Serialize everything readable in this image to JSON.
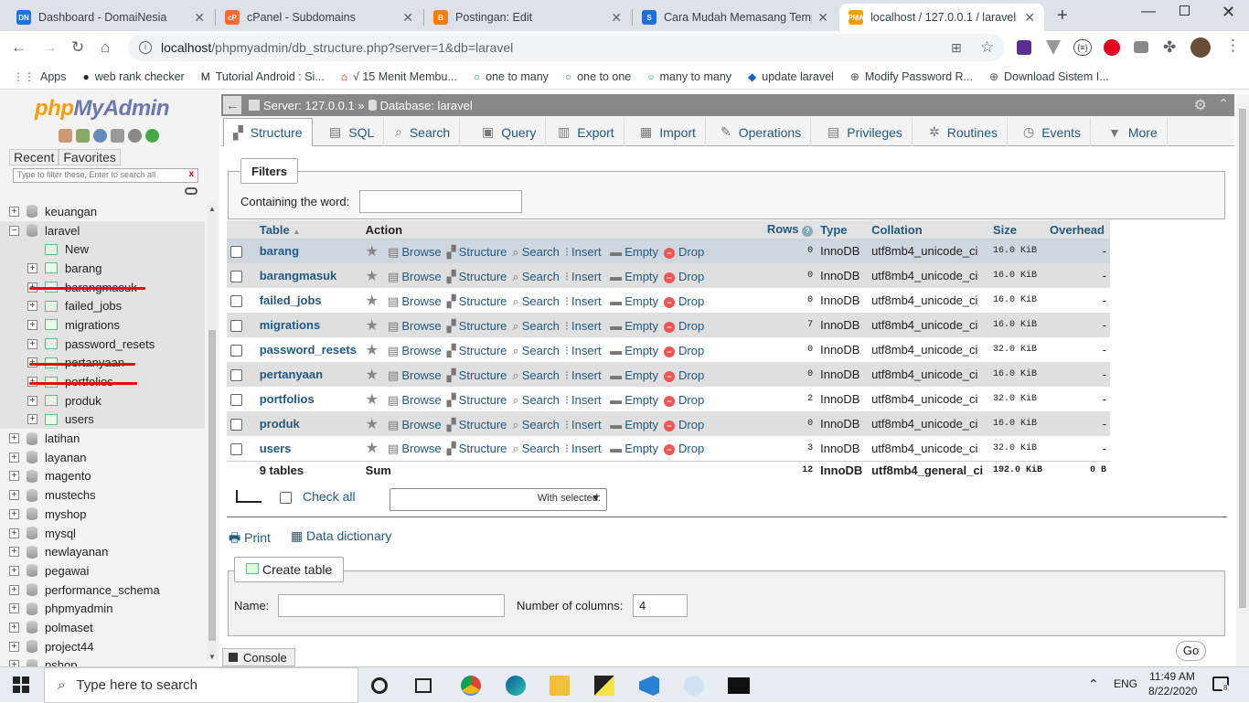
{
  "browser": {
    "tabs": [
      {
        "title": "Dashboard - DomaiNesia",
        "fav_color": "#1a73e8",
        "fav_text": "DN"
      },
      {
        "title": "cPanel - Subdomains",
        "fav_color": "#ff6c2c",
        "fav_text": "cP"
      },
      {
        "title": "Postingan: Edit",
        "fav_color": "#f57c00",
        "fav_text": "B"
      },
      {
        "title": "Cara Mudah Memasang Templ",
        "fav_color": "#1e6fd9",
        "fav_text": "S"
      },
      {
        "title": "localhost / 127.0.0.1 / laravel | ",
        "fav_color": "#f89c0e",
        "fav_text": "PMA"
      }
    ],
    "url_host": "localhost",
    "url_path": "/phpmyadmin/db_structure.php?server=1&db=laravel",
    "bookmarks": [
      {
        "icon": "grid-icon",
        "label": "Apps"
      },
      {
        "icon": "web-rank-icon",
        "label": "web rank checker"
      },
      {
        "icon": "m-icon",
        "label": "Tutorial Android : Si..."
      },
      {
        "icon": "home-icon",
        "label": "√ 15 Menit Membu..."
      },
      {
        "icon": "ring-icon",
        "label": "one to many"
      },
      {
        "icon": "ring-icon",
        "label": "one to one"
      },
      {
        "icon": "ring-icon",
        "label": "many to many"
      },
      {
        "icon": "diamond-icon",
        "label": "update laravel"
      },
      {
        "icon": "globe-icon",
        "label": "Modify Password R..."
      },
      {
        "icon": "globe-icon",
        "label": "Download Sistem I..."
      }
    ]
  },
  "nav": {
    "logo_php": "php",
    "logo_my": "MyAdmin",
    "recent": "Recent",
    "favorites": "Favorites",
    "filter_placeholder": "Type to filter these, Enter to search all",
    "filter_clear": "x",
    "databases": [
      {
        "name": "keuangan",
        "expanded": false
      },
      {
        "name": "laravel",
        "expanded": true,
        "children": [
          "New",
          "barang",
          "barangmasuk",
          "failed_jobs",
          "migrations",
          "password_resets",
          "pertanyaan",
          "portfolios",
          "produk",
          "users"
        ]
      },
      {
        "name": "latihan",
        "expanded": false
      },
      {
        "name": "layanan",
        "expanded": false
      },
      {
        "name": "magento",
        "expanded": false
      },
      {
        "name": "mustechs",
        "expanded": false
      },
      {
        "name": "myshop",
        "expanded": false
      },
      {
        "name": "mysql",
        "expanded": false
      },
      {
        "name": "newlayanan",
        "expanded": false
      },
      {
        "name": "pegawai",
        "expanded": false
      },
      {
        "name": "performance_schema",
        "expanded": false
      },
      {
        "name": "phpmyadmin",
        "expanded": false
      },
      {
        "name": "polmaset",
        "expanded": false
      },
      {
        "name": "project44",
        "expanded": false
      },
      {
        "name": "pshop",
        "expanded": false
      }
    ]
  },
  "breadcrumb": {
    "server": "Server: 127.0.0.1 »",
    "database": "Database: laravel"
  },
  "tabs": [
    "Structure",
    "SQL",
    "Search",
    "Query",
    "Export",
    "Import",
    "Operations",
    "Privileges",
    "Routines",
    "Events",
    "More"
  ],
  "filters": {
    "legend": "Filters",
    "label": "Containing the word:",
    "value": ""
  },
  "table": {
    "headers": [
      "Table",
      "Action",
      "Rows",
      "Type",
      "Collation",
      "Size",
      "Overhead"
    ],
    "actions": [
      "Browse",
      "Structure",
      "Search",
      "Insert",
      "Empty",
      "Drop"
    ],
    "rows": [
      {
        "name": "barang",
        "rows": "0",
        "type": "InnoDB",
        "collation": "utf8mb4_unicode_ci",
        "size": "16.0 KiB",
        "overhead": "-"
      },
      {
        "name": "barangmasuk",
        "rows": "0",
        "type": "InnoDB",
        "collation": "utf8mb4_unicode_ci",
        "size": "16.0 KiB",
        "overhead": "-"
      },
      {
        "name": "failed_jobs",
        "rows": "0",
        "type": "InnoDB",
        "collation": "utf8mb4_unicode_ci",
        "size": "16.0 KiB",
        "overhead": "-"
      },
      {
        "name": "migrations",
        "rows": "7",
        "type": "InnoDB",
        "collation": "utf8mb4_unicode_ci",
        "size": "16.0 KiB",
        "overhead": "-"
      },
      {
        "name": "password_resets",
        "rows": "0",
        "type": "InnoDB",
        "collation": "utf8mb4_unicode_ci",
        "size": "32.0 KiB",
        "overhead": "-"
      },
      {
        "name": "pertanyaan",
        "rows": "0",
        "type": "InnoDB",
        "collation": "utf8mb4_unicode_ci",
        "size": "16.0 KiB",
        "overhead": "-"
      },
      {
        "name": "portfolios",
        "rows": "2",
        "type": "InnoDB",
        "collation": "utf8mb4_unicode_ci",
        "size": "32.0 KiB",
        "overhead": "-"
      },
      {
        "name": "produk",
        "rows": "0",
        "type": "InnoDB",
        "collation": "utf8mb4_unicode_ci",
        "size": "16.0 KiB",
        "overhead": "-"
      },
      {
        "name": "users",
        "rows": "3",
        "type": "InnoDB",
        "collation": "utf8mb4_unicode_ci",
        "size": "32.0 KiB",
        "overhead": "-"
      }
    ],
    "summary": {
      "label": "9 tables",
      "sum": "Sum",
      "rows": "12",
      "type": "InnoDB",
      "collation": "utf8mb4_general_ci",
      "size": "192.0 KiB",
      "overhead": "0 B"
    }
  },
  "bulk": {
    "check_all": "Check all",
    "with_selected": "With selected:"
  },
  "links": {
    "print": "Print",
    "data_dictionary": "Data dictionary"
  },
  "create": {
    "legend": "Create table",
    "name_label": "Name:",
    "name_value": "",
    "columns_label": "Number of columns:",
    "columns_value": "4",
    "go": "Go"
  },
  "console": "Console",
  "taskbar": {
    "search_placeholder": "Type here to search",
    "lang": "ENG",
    "time": "11:49 AM",
    "date": "8/22/2020",
    "notifications": "8"
  }
}
